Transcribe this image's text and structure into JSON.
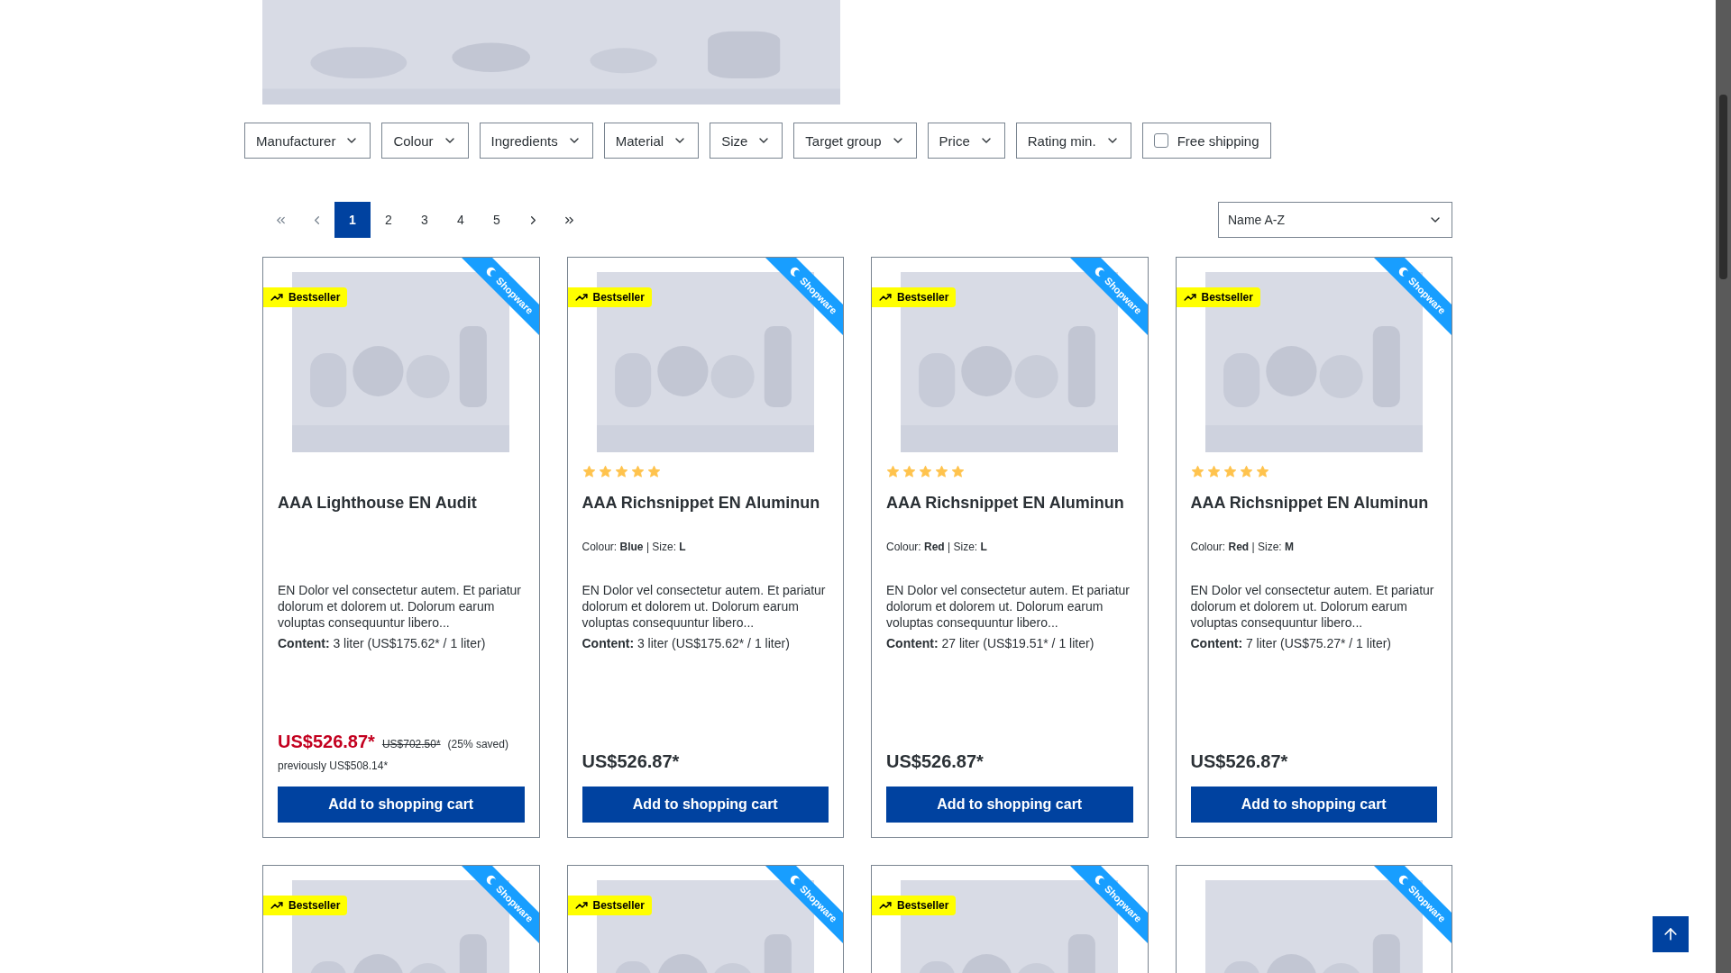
{
  "filters": [
    {
      "kind": "dropdown",
      "label": "Manufacturer"
    },
    {
      "kind": "dropdown",
      "label": "Colour"
    },
    {
      "kind": "dropdown",
      "label": "Ingredients"
    },
    {
      "kind": "dropdown",
      "label": "Material"
    },
    {
      "kind": "dropdown",
      "label": "Size"
    },
    {
      "kind": "dropdown",
      "label": "Target group"
    },
    {
      "kind": "dropdown",
      "label": "Price"
    },
    {
      "kind": "dropdown",
      "label": "Rating min."
    },
    {
      "kind": "checkbox",
      "label": "Free shipping",
      "checked": false
    }
  ],
  "pagination": {
    "pages": [
      {
        "label": "1",
        "selected": true
      },
      {
        "label": "2",
        "selected": false
      },
      {
        "label": "3",
        "selected": false
      },
      {
        "label": "4",
        "selected": false
      },
      {
        "label": "5",
        "selected": false
      }
    ]
  },
  "sort": {
    "value": "Name A-Z"
  },
  "products": [
    {
      "badge": "Bestseller",
      "ribbon": "Shopware",
      "title": "AAA Lighthouse EN Audit",
      "description": "EN Dolor vel consectetur autem. Et pariatur dolorum et dolorem ut. Dolorum earum voluptas consequuntur libero...",
      "content": "**Content:** 3 liter (US$175.62* / 1 liter)",
      "price": "US$526.87*",
      "sale": true,
      "list_price": "US$702.50*",
      "saved": "(25% saved)",
      "previously": "previously US$508.14*",
      "button": "Add to shopping cart"
    },
    {
      "badge": "Bestseller",
      "ribbon": "Shopware",
      "stars": 5,
      "title": "AAA Richsnippet EN Aluminun",
      "variant": "Colour: **Blue** | Size: **L**",
      "description": "EN Dolor vel consectetur autem. Et pariatur dolorum et dolorem ut. Dolorum earum voluptas consequuntur libero...",
      "content": "**Content:** 3 liter (US$175.62* / 1 liter)",
      "price": "US$526.87*",
      "sale": false,
      "button": "Add to shopping cart"
    },
    {
      "badge": "Bestseller",
      "ribbon": "Shopware",
      "stars": 5,
      "title": "AAA Richsnippet EN Aluminun",
      "variant": "Colour: **Red** | Size: **L**",
      "description": "EN Dolor vel consectetur autem. Et pariatur dolorum et dolorem ut. Dolorum earum voluptas consequuntur libero...",
      "content": "**Content:** 27 liter (US$19.51* / 1 liter)",
      "price": "US$526.87*",
      "sale": false,
      "button": "Add to shopping cart"
    },
    {
      "badge": "Bestseller",
      "ribbon": "Shopware",
      "stars": 5,
      "title": "AAA Richsnippet EN Aluminun",
      "variant": "Colour: **Red** | Size: **M**",
      "description": "EN Dolor vel consectetur autem. Et pariatur dolorum et dolorem ut. Dolorum earum voluptas consequuntur libero...",
      "content": "**Content:** 7 liter (US$75.27* / 1 liter)",
      "price": "US$526.87*",
      "sale": false,
      "button": "Add to shopping cart"
    },
    {
      "badge": "Bestseller",
      "ribbon": "Shopware"
    },
    {
      "badge": "Bestseller",
      "ribbon": "Shopware"
    },
    {
      "badge": "Bestseller",
      "ribbon": "Shopware"
    },
    {
      "ribbon": "Shopware"
    }
  ]
}
